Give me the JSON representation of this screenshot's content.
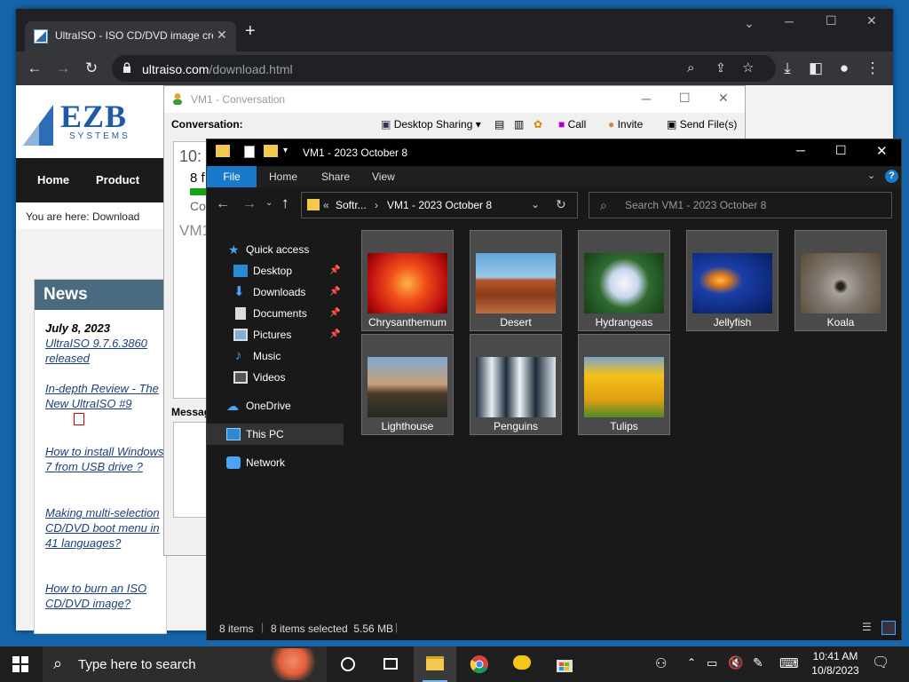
{
  "chrome": {
    "tab_title": "UltraISO - ISO CD/DVD image cre",
    "url_host": "ultraiso.com",
    "url_path": "/download.html"
  },
  "site": {
    "logo_main": "EZB",
    "logo_sub": "SYSTEMS",
    "nav": [
      "Home",
      "Product"
    ],
    "breadcrumb": "You are here: Download",
    "news_title": "News",
    "news_date": "July 8, 2023",
    "news_items": [
      "UltraISO 9.7.6.3860 released",
      "In-depth Review - The New UltraISO #9",
      "How to install Windows 7 from USB drive ?",
      "Making multi-selection CD/DVD boot menu in 41 languages?",
      "How to burn an ISO CD/DVD image?"
    ]
  },
  "conversation": {
    "title": "VM1 - Conversation",
    "label": "Conversation:",
    "desktop_sharing": "Desktop Sharing",
    "call": "Call",
    "invite": "Invite",
    "send_files": "Send File(s)",
    "time_partial": "10:",
    "line_partial": "8 f",
    "co_partial": "Co",
    "vm_partial": "VM1",
    "message_label": "Messag"
  },
  "explorer": {
    "title": "VM1 - 2023 October 8",
    "ribbon_tabs": [
      "File",
      "Home",
      "Share",
      "View"
    ],
    "path_prefix": "«",
    "path_1": "Softr...",
    "path_2": "VM1 - 2023 October 8",
    "search_placeholder": "Search VM1 - 2023 October 8",
    "nav": [
      "Quick access",
      "Desktop",
      "Downloads",
      "Documents",
      "Pictures",
      "Music",
      "Videos",
      "OneDrive",
      "This PC",
      "Network"
    ],
    "files": [
      "Chrysanthemum",
      "Desert",
      "Hydrangeas",
      "Jellyfish",
      "Koala",
      "Lighthouse",
      "Penguins",
      "Tulips"
    ],
    "status_items": "8 items",
    "status_selected": "8 items selected  5.56 MB"
  },
  "taskbar": {
    "search_placeholder": "Type here to search",
    "time": "10:41 AM",
    "date": "10/8/2023"
  },
  "colors": {
    "accent": "#1979ca",
    "desktop": "#1565a8",
    "tile_selected": "#4a4a4a"
  }
}
